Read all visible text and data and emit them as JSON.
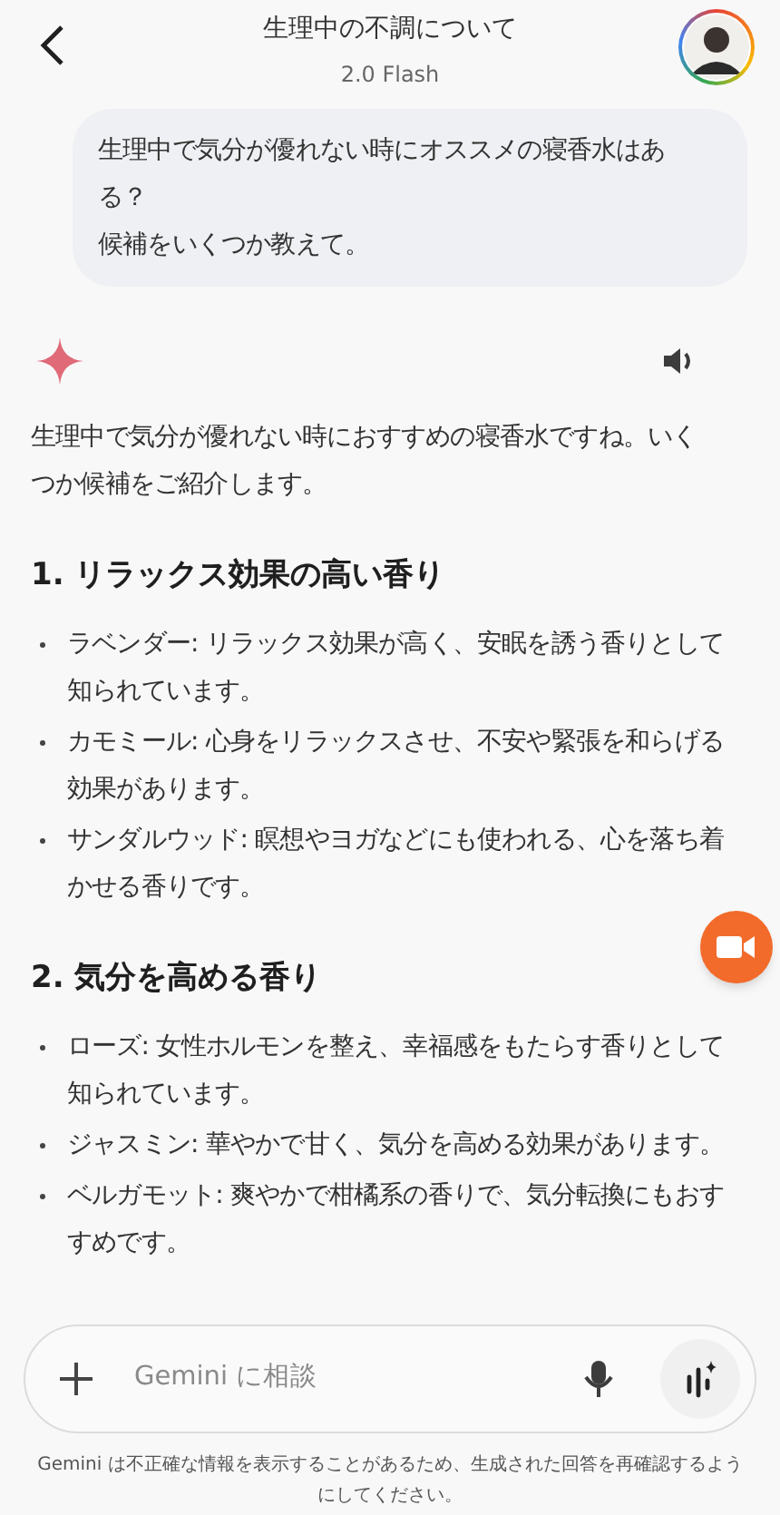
{
  "header": {
    "title": "生理中の不調について",
    "model": "2.0 Flash"
  },
  "user_message": {
    "lines": [
      "生理中で気分が優れない時にオススメの寝香水はある？",
      "候補をいくつか教えて。"
    ]
  },
  "response": {
    "intro": "生理中で気分が優れない時におすすめの寝香水ですね。いくつか候補をご紹介します。",
    "sections": [
      {
        "heading": "1. リラックス効果の高い香り",
        "bullets": [
          "ラベンダー: リラックス効果が高く、安眠を誘う香りとして知られています。",
          "カモミール: 心身をリラックスさせ、不安や緊張を和らげる効果があります。",
          "サンダルウッド: 瞑想やヨガなどにも使われる、心を落ち着かせる香りです。"
        ]
      },
      {
        "heading": "2. 気分を高める香り",
        "bullets": [
          "ローズ: 女性ホルモンを整え、幸福感をもたらす香りとして知られています。",
          "ジャスミン: 華やかで甘く、気分を高める効果があります。",
          "ベルガモット: 爽やかで柑橘系の香りで、気分転換にもおすすめです。"
        ]
      }
    ]
  },
  "input": {
    "placeholder": "Gemini に相談"
  },
  "disclaimer": "Gemini は不正確な情報を表示することがあるため、生成された回答を再確認するようにしてください。"
}
